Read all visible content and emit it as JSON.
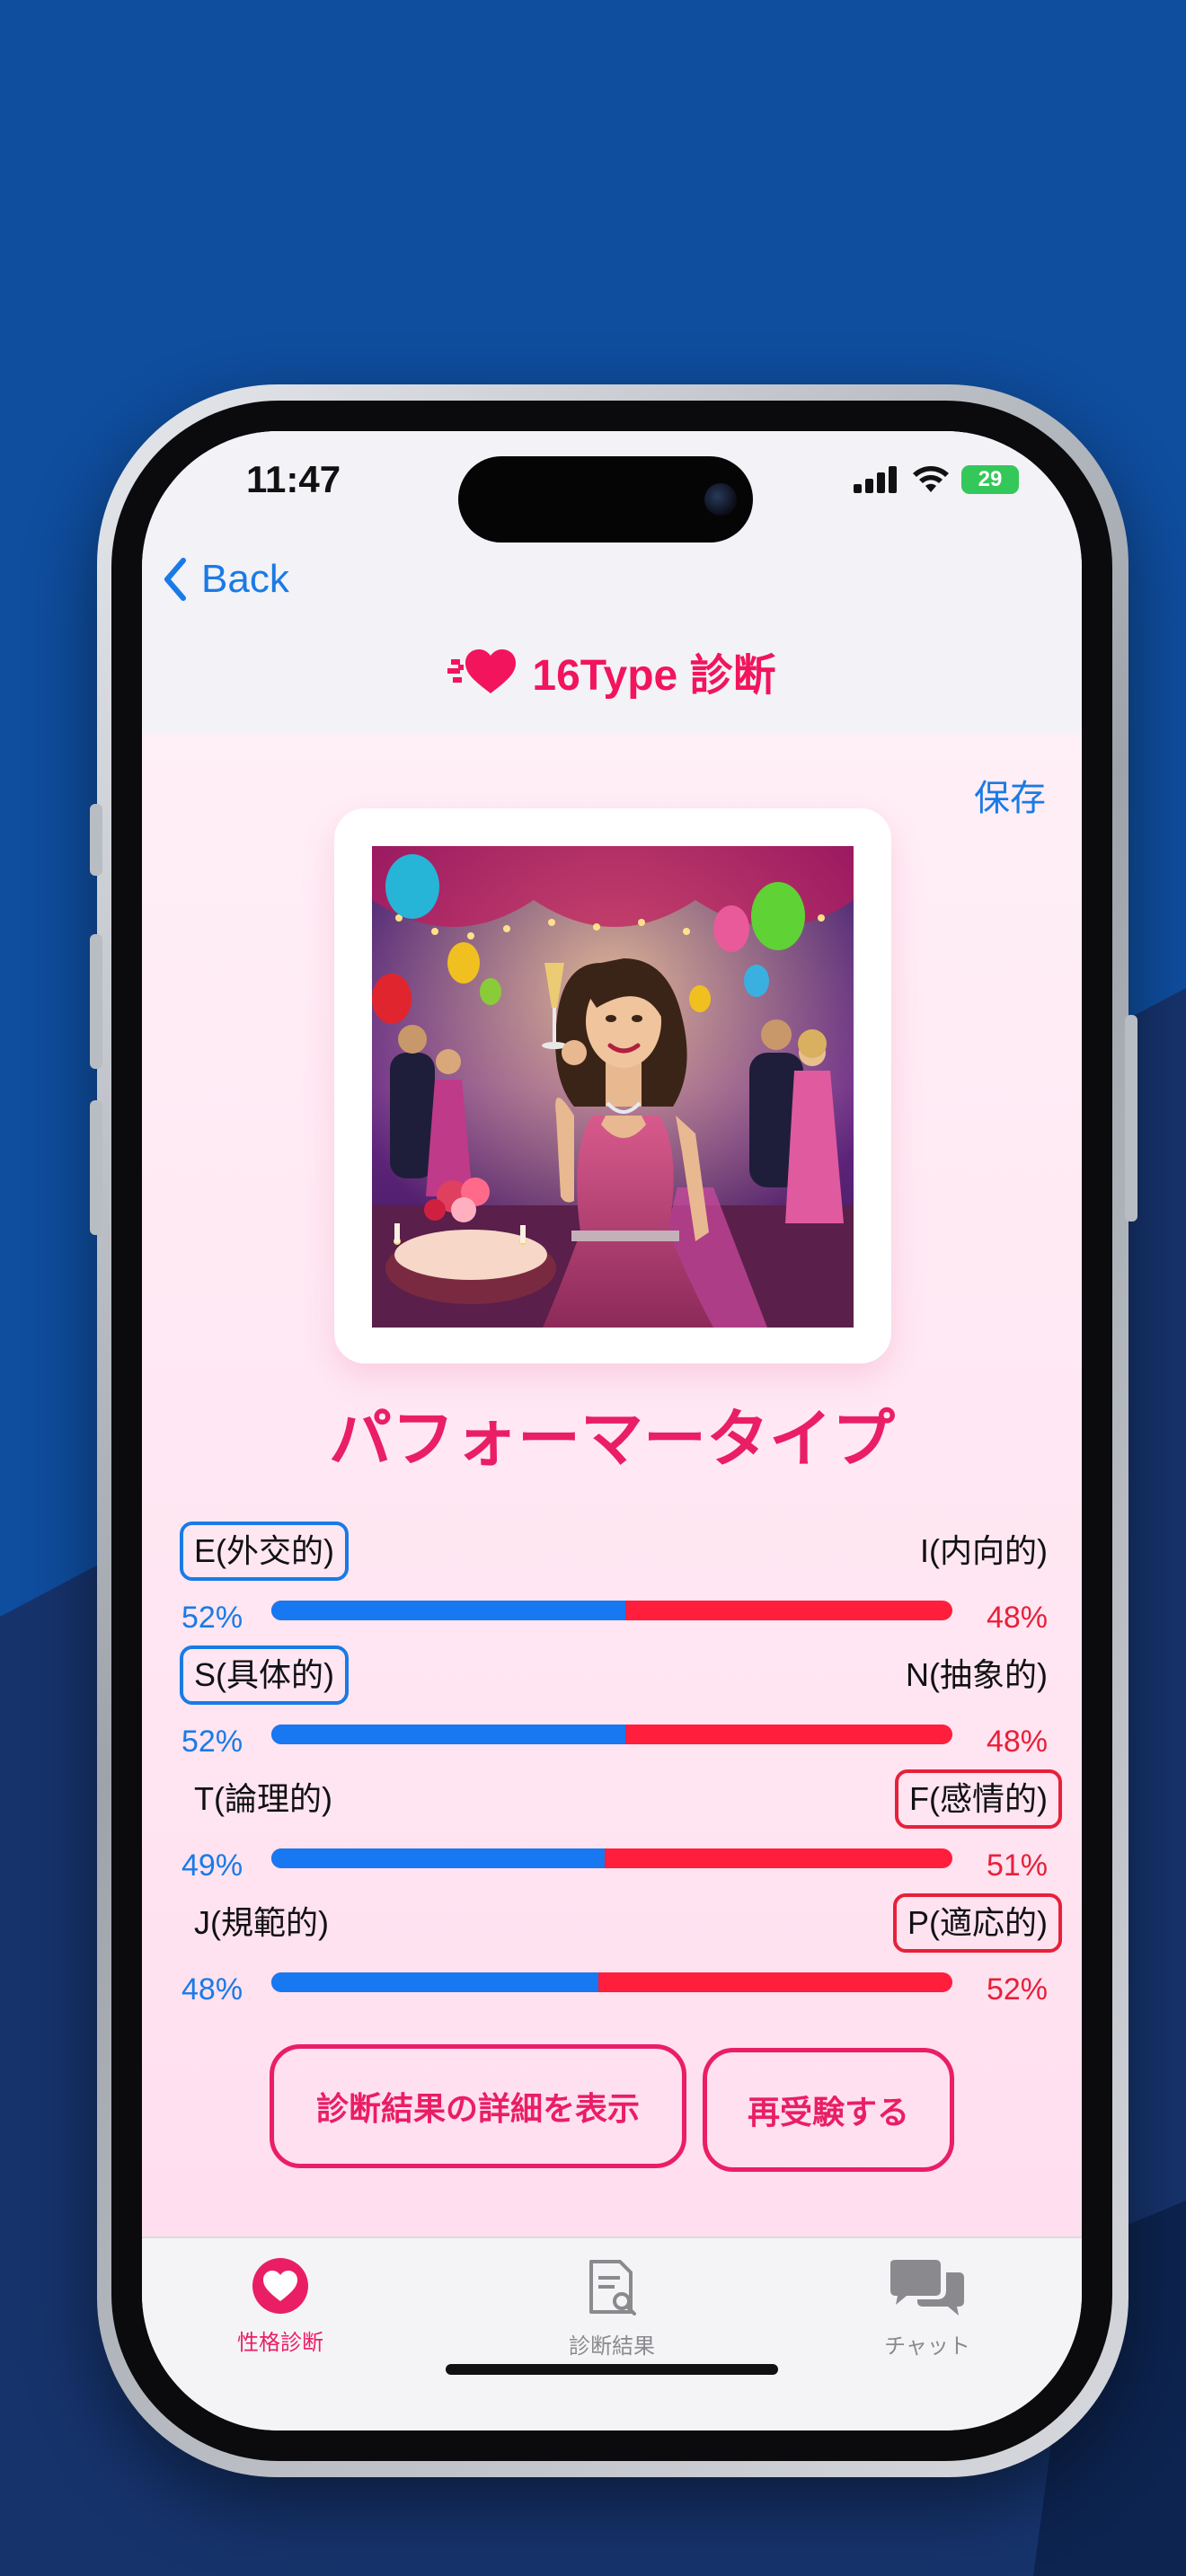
{
  "colors": {
    "accent_pink": "#ea1e64",
    "link_blue": "#1a7ae6",
    "bar_blue": "#1778f2",
    "bar_red": "#ff1e3c",
    "background_blue": "#0f4d9e"
  },
  "status_bar": {
    "time": "11:47",
    "battery": "29",
    "icons": [
      "signal-icon",
      "wifi-icon",
      "battery-charging-icon"
    ]
  },
  "nav": {
    "back_label": "Back",
    "title": "16Type 診断",
    "logo_icon": "heart-icon"
  },
  "result": {
    "save_label": "保存",
    "image_alt": "party-woman-illustration",
    "type_name": "パフォーマータイプ",
    "traits": [
      {
        "left": "E(外交的)",
        "right": "I(内向的)",
        "left_pct": "52%",
        "right_pct": "48%",
        "left_value": 52,
        "selected": "left"
      },
      {
        "left": "S(具体的)",
        "right": "N(抽象的)",
        "left_pct": "52%",
        "right_pct": "48%",
        "left_value": 52,
        "selected": "left"
      },
      {
        "left": "T(論理的)",
        "right": "F(感情的)",
        "left_pct": "49%",
        "right_pct": "51%",
        "left_value": 49,
        "selected": "right"
      },
      {
        "left": "J(規範的)",
        "right": "P(適応的)",
        "left_pct": "48%",
        "right_pct": "52%",
        "left_value": 48,
        "selected": "right"
      }
    ],
    "detail_button": "診断結果の詳細を表示",
    "retake_button": "再受験する"
  },
  "tabbar": {
    "tabs": [
      {
        "label": "性格診断",
        "icon": "heart-icon",
        "active": true
      },
      {
        "label": "診断結果",
        "icon": "document-search-icon",
        "active": false
      },
      {
        "label": "チャット",
        "icon": "chat-bubbles-icon",
        "active": false
      }
    ]
  }
}
